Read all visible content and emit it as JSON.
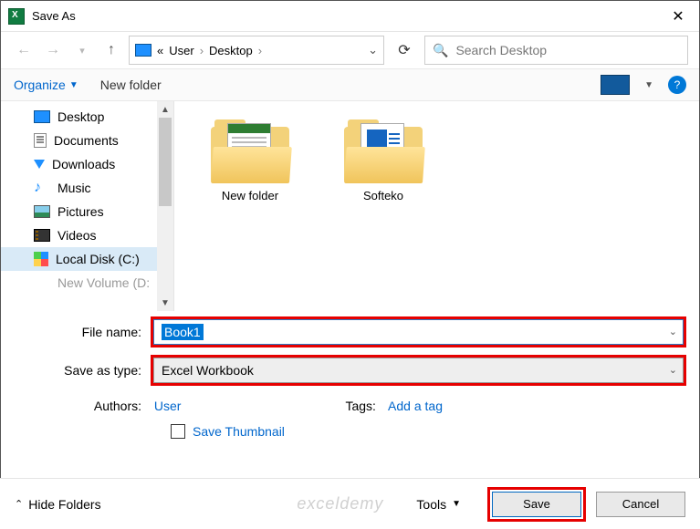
{
  "window": {
    "title": "Save As"
  },
  "nav": {
    "breadcrumb_prefix": "«",
    "crumb1": "User",
    "crumb2": "Desktop"
  },
  "search": {
    "placeholder": "Search Desktop"
  },
  "toolbar": {
    "organize": "Organize",
    "newfolder": "New folder"
  },
  "tree": {
    "desktop": "Desktop",
    "documents": "Documents",
    "downloads": "Downloads",
    "music": "Music",
    "pictures": "Pictures",
    "videos": "Videos",
    "localdisk": "Local Disk (C:)",
    "cutoff": "New Volume (D:"
  },
  "items": {
    "folder1": "New folder",
    "folder2": "Softeko"
  },
  "form": {
    "fn_label": "File name:",
    "fn_value": "Book1",
    "type_label": "Save as type:",
    "type_value": "Excel Workbook",
    "authors_label": "Authors:",
    "authors_value": "User",
    "tags_label": "Tags:",
    "tags_value": "Add a tag",
    "thumb": "Save Thumbnail"
  },
  "footer": {
    "hide": "Hide Folders",
    "tools": "Tools",
    "save": "Save",
    "cancel": "Cancel",
    "watermark": "exceldemy"
  }
}
